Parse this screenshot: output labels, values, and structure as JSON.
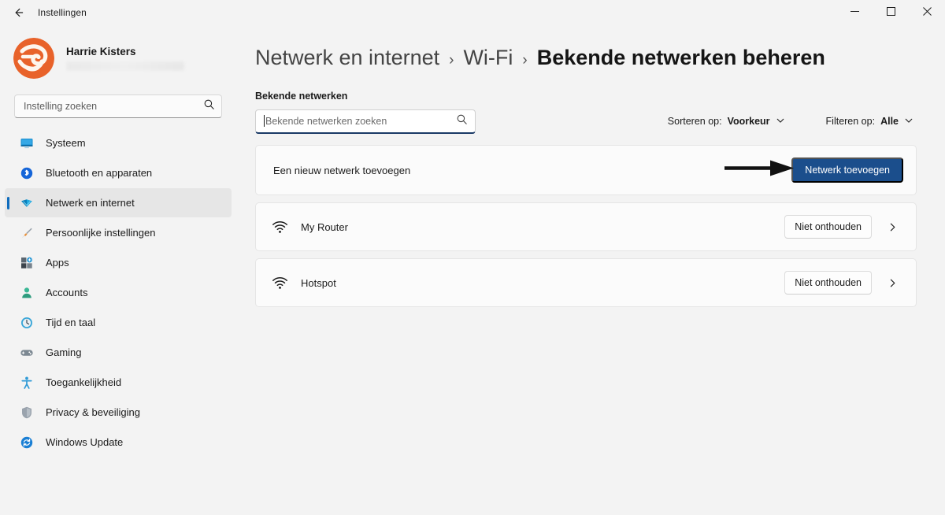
{
  "window": {
    "title": "Instellingen",
    "back_icon": "back-arrow-icon",
    "minimize_label": "—",
    "maximize_label": "□",
    "close_label": "✕"
  },
  "sidebar": {
    "profile": {
      "name": "Harrie Kisters",
      "avatar_name": "harrie-kisters-avatar",
      "email_redacted": ""
    },
    "search": {
      "placeholder": "Instelling zoeken",
      "value": "",
      "icon": "search-icon"
    },
    "items": [
      {
        "label": "Systeem",
        "icon": "monitor-icon",
        "selected": false
      },
      {
        "label": "Bluetooth en apparaten",
        "icon": "bluetooth-icon",
        "selected": false
      },
      {
        "label": "Netwerk en internet",
        "icon": "network-wifi-icon",
        "selected": true
      },
      {
        "label": "Persoonlijke instellingen",
        "icon": "paintbrush-icon",
        "selected": false
      },
      {
        "label": "Apps",
        "icon": "apps-grid-icon",
        "selected": false
      },
      {
        "label": "Accounts",
        "icon": "person-icon",
        "selected": false
      },
      {
        "label": "Tijd en taal",
        "icon": "clock-icon",
        "selected": false
      },
      {
        "label": "Gaming",
        "icon": "gamepad-icon",
        "selected": false
      },
      {
        "label": "Toegankelijkheid",
        "icon": "accessibility-icon",
        "selected": false
      },
      {
        "label": "Privacy & beveiliging",
        "icon": "shield-icon",
        "selected": false
      },
      {
        "label": "Windows Update",
        "icon": "update-refresh-icon",
        "selected": false
      }
    ]
  },
  "main": {
    "breadcrumb": {
      "items": [
        "Netwerk en internet",
        "Wi-Fi",
        "Bekende netwerken beheren"
      ],
      "separator": "›"
    },
    "section_label": "Bekende netwerken",
    "search": {
      "placeholder": "Bekende netwerken zoeken",
      "value": "",
      "icon": "search-icon"
    },
    "sort": {
      "label": "Sorteren op:",
      "value": "Voorkeur",
      "icon": "chevron-down-icon"
    },
    "filter": {
      "label": "Filteren op:",
      "value": "Alle",
      "icon": "chevron-down-icon"
    },
    "add_card": {
      "title": "Een nieuw netwerk toevoegen",
      "button_label": "Netwerk toevoegen",
      "annotation": "pointing-arrow"
    },
    "networks": [
      {
        "name": "My Router",
        "icon": "wifi-icon",
        "button_label": "Niet onthouden",
        "chevron": "chevron-right-icon"
      },
      {
        "name": "Hotspot",
        "icon": "wifi-icon",
        "button_label": "Niet onthouden",
        "chevron": "chevron-right-icon"
      }
    ]
  },
  "colors": {
    "accent": "#0f6cbd",
    "primary_button": "#1b4e8c",
    "page_bg": "#f3f3f3",
    "card_bg": "#fbfbfb",
    "avatar_orange": "#e8622a",
    "focus_underline": "#1b3a66"
  }
}
